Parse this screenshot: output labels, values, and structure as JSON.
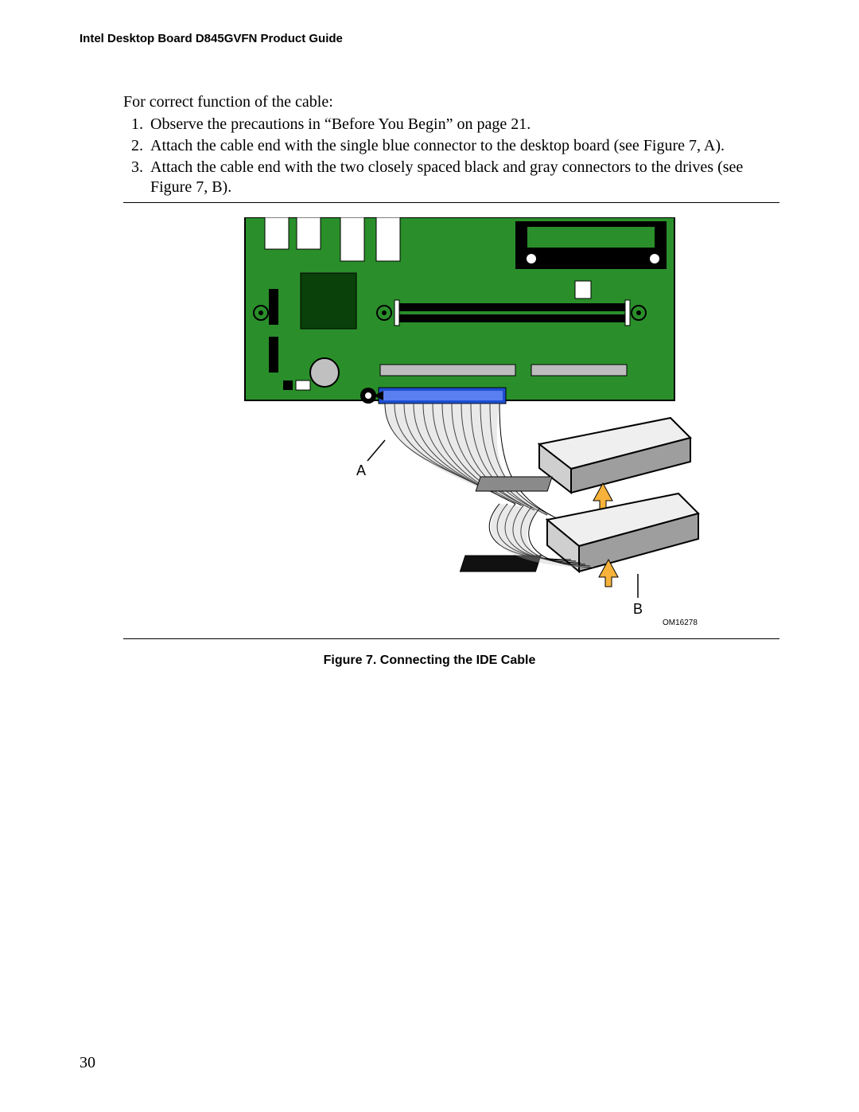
{
  "header": {
    "running_title": "Intel Desktop Board D845GVFN Product Guide"
  },
  "body": {
    "intro": "For correct function of the cable:",
    "steps": [
      "Observe the precautions in “Before You Begin” on page 21.",
      "Attach the cable end with the single blue connector to the desktop board (see Figure 7, A).",
      "Attach the cable end with the two closely spaced black and gray connectors to the drives (see Figure 7, B)."
    ]
  },
  "figure": {
    "caption": "Figure 7.  Connecting the IDE Cable",
    "label_a": "A",
    "label_b": "B",
    "image_id": "OM16278"
  },
  "footer": {
    "page_number": "30"
  }
}
